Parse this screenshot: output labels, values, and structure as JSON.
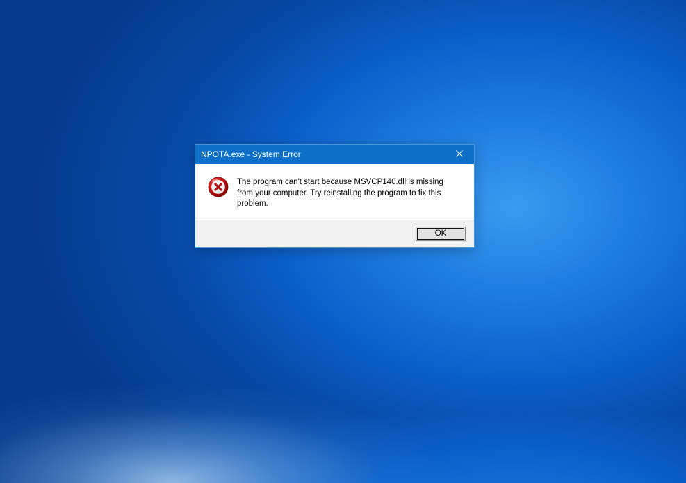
{
  "dialog": {
    "title": "NPOTA.exe - System Error",
    "message": "The program can't start because MSVCP140.dll is missing from your computer. Try reinstalling the program to fix this problem.",
    "ok_label": "OK"
  }
}
